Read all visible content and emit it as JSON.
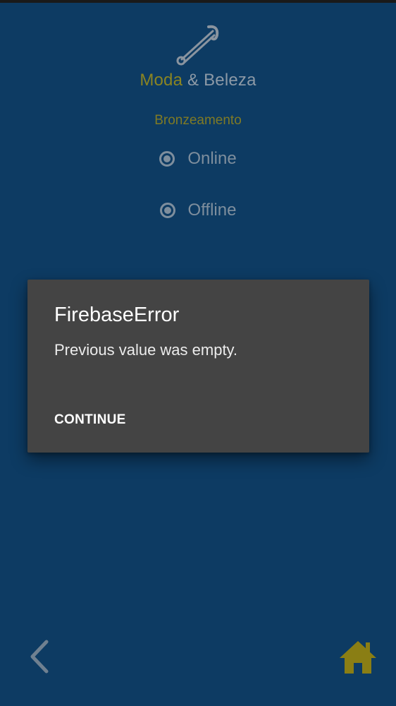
{
  "header": {
    "logo_icon": "safety-pin-icon",
    "brand_part1": "Moda",
    "brand_part2": " & Beleza",
    "subtitle": "Bronzeamento"
  },
  "options": {
    "online_label": "Online",
    "offline_label": "Offline"
  },
  "dialog": {
    "title": "FirebaseError",
    "message": "Previous value was empty.",
    "button_label": "CONTINUE"
  },
  "bottom_nav": {
    "back_icon": "chevron-left-icon",
    "home_icon": "home-icon"
  },
  "colors": {
    "background": "#0d3b63",
    "accent": "#8a8422",
    "dialog_background": "#444444"
  }
}
